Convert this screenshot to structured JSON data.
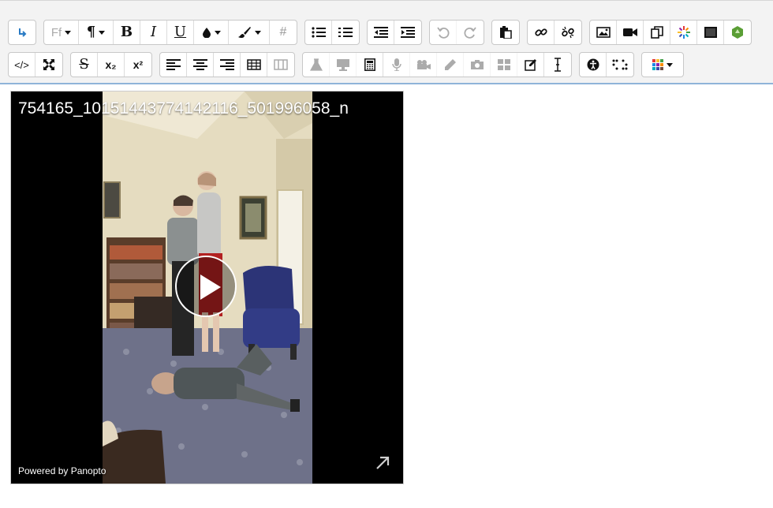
{
  "toolbar": {
    "row1": [
      {
        "name": "collapse-button",
        "icon": "arrow-down-right-icon"
      },
      {
        "name": "font-family-button",
        "label": "Ff",
        "icon": "font-icon"
      },
      {
        "name": "paragraph-style-button",
        "icon": "pilcrow-icon"
      },
      {
        "name": "bold-button",
        "label": "B"
      },
      {
        "name": "italic-button",
        "label": "I"
      },
      {
        "name": "underline-button",
        "label": "U"
      },
      {
        "name": "text-color-button",
        "icon": "droplet-icon"
      },
      {
        "name": "background-color-button",
        "icon": "paintbrush-icon"
      },
      {
        "name": "hash-button",
        "label": "#"
      },
      {
        "name": "bullet-list-button",
        "icon": "bullet-list-icon"
      },
      {
        "name": "numbered-list-button",
        "icon": "numbered-list-icon"
      },
      {
        "name": "outdent-button",
        "icon": "outdent-icon"
      },
      {
        "name": "indent-button",
        "icon": "indent-icon"
      },
      {
        "name": "undo-button",
        "icon": "undo-icon"
      },
      {
        "name": "redo-button",
        "icon": "redo-icon"
      },
      {
        "name": "paste-button",
        "icon": "clipboard-icon"
      },
      {
        "name": "link-button",
        "icon": "link-icon"
      },
      {
        "name": "unlink-button",
        "icon": "unlink-icon"
      },
      {
        "name": "insert-image-button",
        "icon": "image-icon"
      },
      {
        "name": "insert-media-button",
        "icon": "video-camera-icon"
      },
      {
        "name": "manage-files-button",
        "icon": "copy-icon"
      },
      {
        "name": "h5p-button",
        "icon": "spark-icon"
      },
      {
        "name": "screen-button",
        "icon": "monitor-icon"
      },
      {
        "name": "recycle-button",
        "icon": "recycle-icon"
      }
    ],
    "row2": [
      {
        "name": "html-source-button",
        "label": "</>"
      },
      {
        "name": "fullscreen-button",
        "icon": "expand-icon"
      },
      {
        "name": "strikethrough-button",
        "label": "S"
      },
      {
        "name": "subscript-button",
        "label": "x₂"
      },
      {
        "name": "superscript-button",
        "label": "x²"
      },
      {
        "name": "align-left-button",
        "icon": "align-left-icon"
      },
      {
        "name": "align-center-button",
        "icon": "align-center-icon"
      },
      {
        "name": "align-right-button",
        "icon": "align-right-icon"
      },
      {
        "name": "table-button",
        "icon": "table-icon"
      },
      {
        "name": "columns-button",
        "icon": "columns-icon"
      },
      {
        "name": "chemistry-button",
        "icon": "flask-icon"
      },
      {
        "name": "screenshare-button",
        "icon": "desktop-icon"
      },
      {
        "name": "calculator-button",
        "icon": "calculator-icon"
      },
      {
        "name": "record-audio-button",
        "icon": "microphone-icon"
      },
      {
        "name": "record-video-button",
        "icon": "camcorder-icon"
      },
      {
        "name": "draw-button",
        "icon": "pencil-icon"
      },
      {
        "name": "photo-button",
        "icon": "camera-icon"
      },
      {
        "name": "template-button",
        "icon": "layout-icon"
      },
      {
        "name": "edit-button",
        "icon": "edit-icon"
      },
      {
        "name": "text-cursor-button",
        "icon": "i-beam-icon"
      },
      {
        "name": "accessibility-button",
        "icon": "accessibility-icon"
      },
      {
        "name": "braille-button",
        "icon": "braille-icon"
      },
      {
        "name": "more-apps-button",
        "icon": "grid-colored-icon"
      }
    ]
  },
  "video": {
    "title": "754165_10151443774142116_501996058_n",
    "powered_by": "Powered by Panopto"
  },
  "colors": {
    "toolbar_bg": "#f3f3f3",
    "editor_border": "#8fb4d9",
    "wall": "#e9e1c8",
    "carpet": "#6e7189"
  }
}
